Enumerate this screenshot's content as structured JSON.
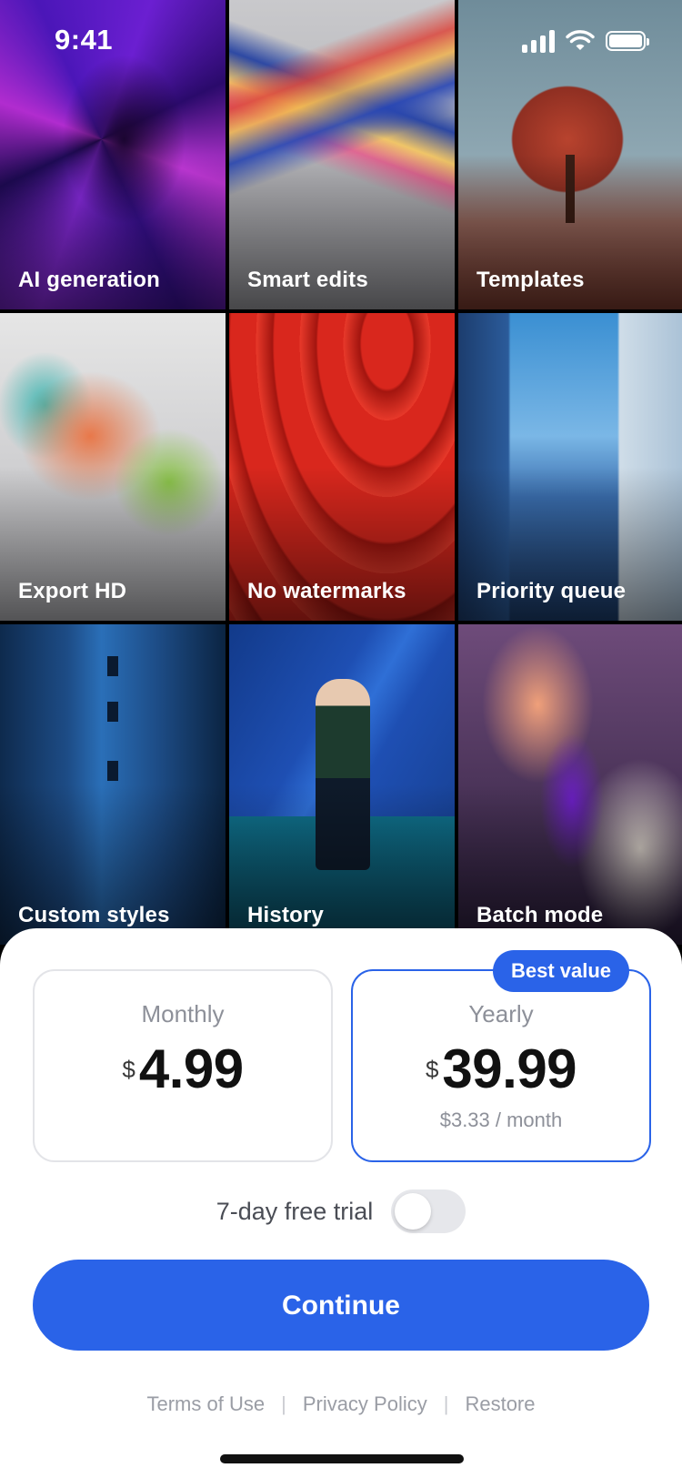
{
  "status_bar": {
    "time": "9:41"
  },
  "features": [
    {
      "label": "AI generation"
    },
    {
      "label": "Smart edits"
    },
    {
      "label": "Templates"
    },
    {
      "label": "Export HD"
    },
    {
      "label": "No watermarks"
    },
    {
      "label": "Priority queue"
    },
    {
      "label": "Custom styles"
    },
    {
      "label": "History"
    },
    {
      "label": "Batch mode"
    }
  ],
  "plans": {
    "monthly": {
      "name": "Monthly",
      "currency": "$",
      "amount": "4.99"
    },
    "yearly": {
      "name": "Yearly",
      "currency": "$",
      "amount": "39.99",
      "per_month": "$3.33 / month",
      "badge": "Best value",
      "selected": true
    }
  },
  "trial": {
    "label": "7-day free trial",
    "enabled": false
  },
  "cta": {
    "label": "Continue"
  },
  "footer_links": [
    "Terms of Use",
    "Privacy Policy",
    "Restore"
  ],
  "colors": {
    "accent": "#2A63E8",
    "sheet_background": "#FFFFFF",
    "muted_text": "#8D9099"
  }
}
